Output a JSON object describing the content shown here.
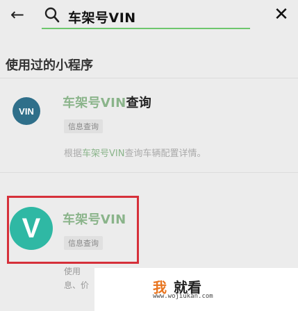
{
  "search": {
    "query": "车架号VIN"
  },
  "section": {
    "title": "使用过的小程序"
  },
  "items": [
    {
      "logo_text": "VIN",
      "name_highlight": "车架号VIN",
      "name_rest": "查询",
      "tag": "信息查询",
      "desc_prefix": "根据",
      "desc_highlight": "车架号VIN",
      "desc_rest": "查询车辆配置详情。"
    },
    {
      "logo_text": "V",
      "name_highlight": "车架号VIN",
      "tag": "信息查询",
      "partial_line1": "使用",
      "partial_line2": "息、价"
    }
  ],
  "watermark": {
    "brand_first": "我",
    "brand_rest": "就看",
    "url": "www.wojiukan.com"
  },
  "colors": {
    "background": "#ececec",
    "highlight": "#8ab48a",
    "red_box": "#d6303a",
    "logo1": "#2f6f8a",
    "logo2": "#2fb8a4",
    "watermark_accent": "#e8741e"
  }
}
